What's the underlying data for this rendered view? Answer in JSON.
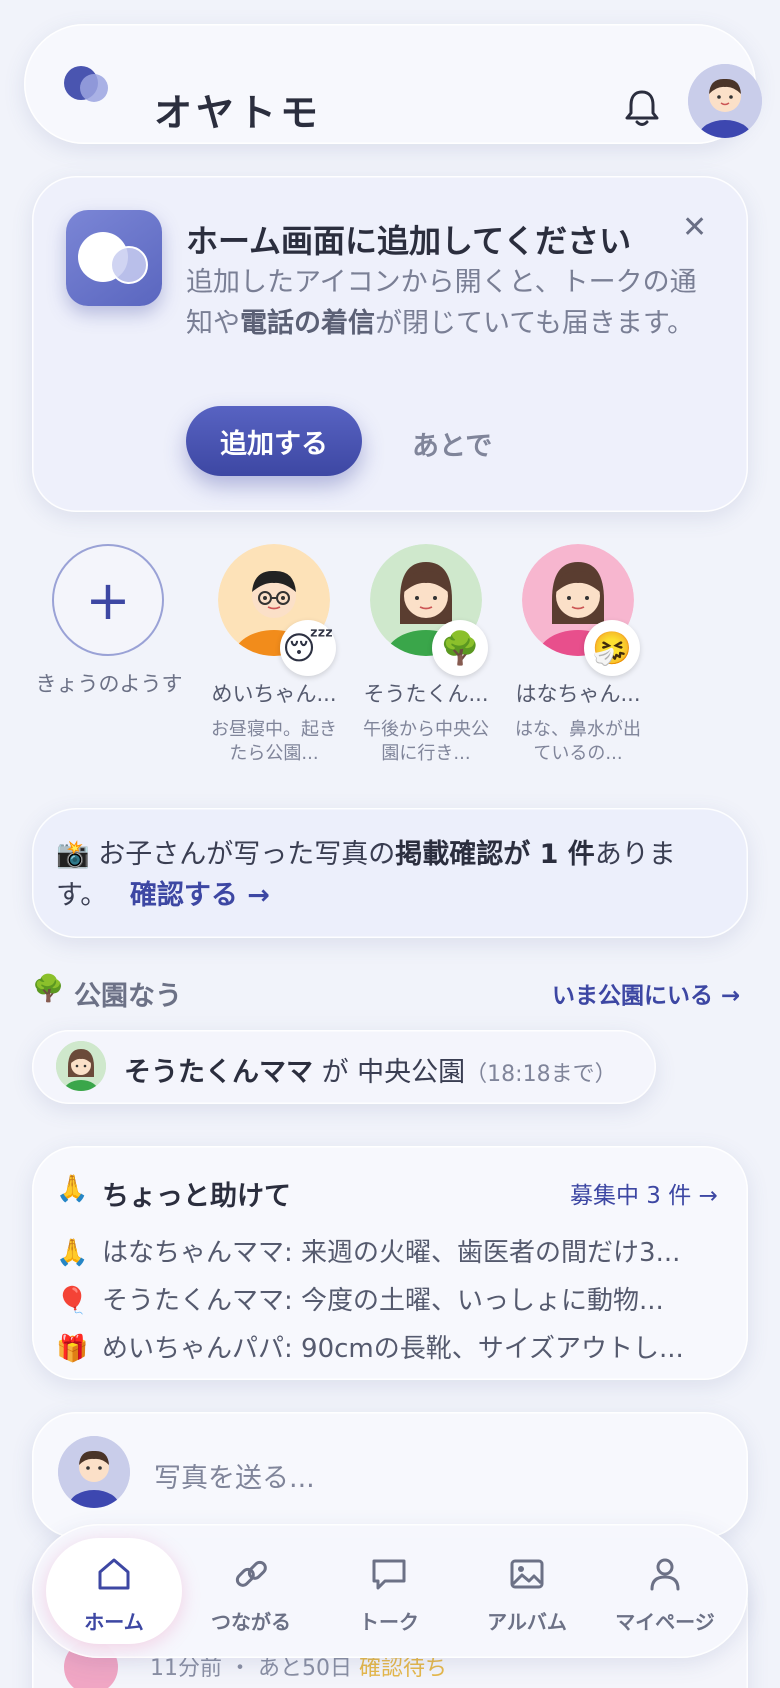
{
  "header": {
    "app_title": "オヤトモ"
  },
  "install_prompt": {
    "title": "ホーム画面に追加してください",
    "body_before": "追加したアイコンから開くと、トークの通知や",
    "body_bold": "電話の着信",
    "body_after": "が閉じていても届きます。",
    "add_label": "追加する",
    "later_label": "あとで",
    "close_label": "✕"
  },
  "stories": {
    "add_label": "きょうのようす",
    "add_symbol": "+",
    "items": [
      {
        "name": "めいちゃん...",
        "note": "お昼寝中。起きたら公園...",
        "emoji": "😴",
        "face_bg": "#fde2b8",
        "shirt": "#f28c1b"
      },
      {
        "name": "そうたくん...",
        "note": "午後から中央公園に行き...",
        "emoji": "🌳",
        "face_bg": "#cfe8cc",
        "shirt": "#3aa64a"
      },
      {
        "name": "はなちゃん...",
        "note": "はな、鼻水が出ているの...",
        "emoji": "🤧",
        "face_bg": "#f7b6cf",
        "shirt": "#e84f8c"
      }
    ]
  },
  "photo_confirm": {
    "icon": "📸",
    "text_before": "お子さんが写った写真の",
    "text_bold": "掲載確認が 1 件",
    "text_after": "あります。",
    "link": "確認する →"
  },
  "park": {
    "icon": "🌳",
    "title": "公園なう",
    "link": "いま公園にいる →",
    "entry": {
      "name": "そうたくんママ",
      "connector": " が ",
      "place": "中央公園",
      "time": "（18:18まで）"
    }
  },
  "help": {
    "icon": "🙏",
    "title": "ちょっと助けて",
    "link": "募集中 3 件 →",
    "items": [
      {
        "icon": "🙏",
        "text": "はなちゃんママ: 来週の火曜、歯医者の間だけ3..."
      },
      {
        "icon": "🎈",
        "text": "そうたくんママ: 今度の土曜、いっしょに動物..."
      },
      {
        "icon": "🎁",
        "text": "めいちゃんパパ: 90cmの長靴、サイズアウトし..."
      }
    ]
  },
  "send_photo": {
    "placeholder": "写真を送る..."
  },
  "peek": {
    "text": "11分前 ・ あと50日 ",
    "status": "確認待ち"
  },
  "nav": {
    "items": [
      {
        "label": "ホーム",
        "icon": "home-icon"
      },
      {
        "label": "つながる",
        "icon": "link-icon"
      },
      {
        "label": "トーク",
        "icon": "chat-icon"
      },
      {
        "label": "アルバム",
        "icon": "image-icon"
      },
      {
        "label": "マイページ",
        "icon": "user-icon"
      }
    ]
  },
  "colors": {
    "accent": "#3d47a3",
    "background": "#f1f3fa"
  }
}
